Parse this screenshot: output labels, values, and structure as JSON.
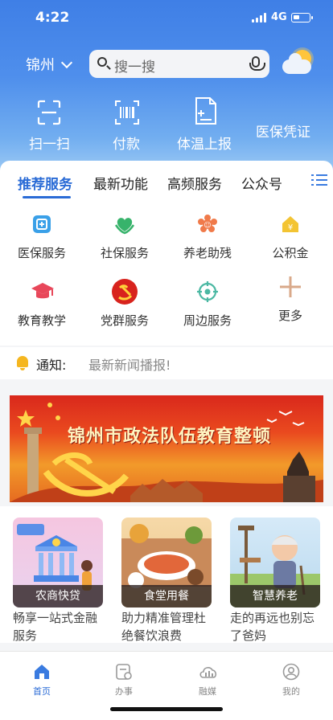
{
  "status": {
    "time": "4:22",
    "network": "4G"
  },
  "header": {
    "city": "锦州",
    "search_placeholder": "搜一搜"
  },
  "quick_actions": [
    {
      "label": "扫一扫",
      "icon": "scan-icon"
    },
    {
      "label": "付款",
      "icon": "barcode-pay-icon"
    },
    {
      "label": "体温上报",
      "icon": "temperature-report-icon"
    },
    {
      "label": "医保凭证",
      "icon": ""
    }
  ],
  "tabs": [
    {
      "label": "推荐服务",
      "active": true
    },
    {
      "label": "最新功能",
      "active": false
    },
    {
      "label": "高频服务",
      "active": false
    },
    {
      "label": "公众号",
      "active": false
    }
  ],
  "services": [
    {
      "label": "医保服务",
      "icon": "medical-insurance-icon"
    },
    {
      "label": "社保服务",
      "icon": "social-security-icon"
    },
    {
      "label": "养老助残",
      "icon": "elderly-care-icon"
    },
    {
      "label": "公积金",
      "icon": "housing-fund-icon"
    },
    {
      "label": "教育教学",
      "icon": "graduation-cap-icon"
    },
    {
      "label": "党群服务",
      "icon": "party-emblem-icon"
    },
    {
      "label": "周边服务",
      "icon": "location-target-icon"
    },
    {
      "label": "更多",
      "icon": "plus-icon"
    }
  ],
  "notice": {
    "label": "通知:",
    "text": "最新新闻播报!"
  },
  "banner": {
    "text": "锦州市政法队伍教育整顿"
  },
  "tiles": [
    {
      "caption": "农商快贷",
      "desc": "畅享一站式金融服务"
    },
    {
      "caption": "食堂用餐",
      "desc": "助力精准管理杜绝餐饮浪费"
    },
    {
      "caption": "智慧养老",
      "desc": "走的再远也别忘了爸妈"
    }
  ],
  "nav": [
    {
      "label": "首页",
      "icon": "home-icon",
      "active": true
    },
    {
      "label": "办事",
      "icon": "service-icon",
      "active": false
    },
    {
      "label": "融媒",
      "icon": "media-cloud-icon",
      "active": false
    },
    {
      "label": "我的",
      "icon": "profile-icon",
      "active": false
    }
  ],
  "colors": {
    "accent": "#2a6bd6",
    "header_top": "#3f7fe6",
    "notice_bell": "#f5b61f"
  }
}
